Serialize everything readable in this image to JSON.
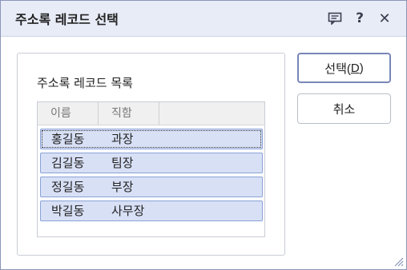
{
  "dialog": {
    "title": "주소록 레코드 선택",
    "icons": [
      "comment-icon",
      "help-icon",
      "close-icon"
    ],
    "help_glyph": "?",
    "close_glyph": "✕"
  },
  "panel": {
    "label": "주소록 레코드 목록",
    "columns": [
      "이름",
      "직함"
    ],
    "rows": [
      {
        "name": "홍길동",
        "title": "과장"
      },
      {
        "name": "김길동",
        "title": "팀장"
      },
      {
        "name": "정길동",
        "title": "부장"
      },
      {
        "name": "박길동",
        "title": "사무장"
      }
    ]
  },
  "buttons": {
    "select_prefix": "선택(",
    "select_mnemonic": "D",
    "select_suffix": ")",
    "cancel_label": "취소"
  },
  "colors": {
    "titlebar_bg": "#e8ecf7",
    "selected_row_bg": "#d8e0f6",
    "selected_row_border": "#8aa2d8",
    "default_button_border": "#7886b8"
  }
}
